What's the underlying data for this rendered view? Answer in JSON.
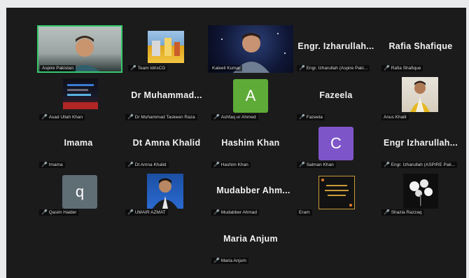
{
  "colors": {
    "meeting_bg": "#1b1b1b",
    "active_speaker_border": "#35c96b",
    "mic_muted": "#e53935",
    "avatar_green": "#5fab37",
    "avatar_purple": "#7e55c9",
    "avatar_slate": "#5f6d75"
  },
  "participants": [
    {
      "label": "Aspire Pakistan",
      "type": "video"
    },
    {
      "label": "Team IdrisCG",
      "type": "image"
    },
    {
      "label": "Kaleeil Kumar",
      "type": "video"
    },
    {
      "name": "Engr.  Izharullah...",
      "label": "Engr. Izharullah (Aspire Paki...",
      "type": "text"
    },
    {
      "name": "Rafia Shafique",
      "label": "Rafia Shafique",
      "type": "text"
    },
    {
      "label": "Asad Ullah Khan",
      "type": "image"
    },
    {
      "name": "Dr  Muhammad...",
      "label": "Dr Muhammad Taskeen Raza",
      "type": "text"
    },
    {
      "initial": "A",
      "label": "Ashfaq ur Ahmed",
      "type": "avatar"
    },
    {
      "name": "Fazeela",
      "label": "Fazeela",
      "type": "text"
    },
    {
      "label": "Anus Khalil",
      "type": "image"
    },
    {
      "name": "Imama",
      "label": "Imama",
      "type": "text"
    },
    {
      "name": "Dt Amna Khalid",
      "label": "Dt Amna Khalid",
      "type": "text"
    },
    {
      "name": "Hashim Khan",
      "label": "Hashim Khan",
      "type": "text"
    },
    {
      "initial": "C",
      "label": "Salman Khan",
      "type": "avatar"
    },
    {
      "name": "Engr   Izharullah...",
      "label": "Engr. Izharullah (ASPIRE Pak...",
      "type": "text"
    },
    {
      "initial": "q",
      "label": "Qasim Haider",
      "type": "avatar"
    },
    {
      "label": "UMAIR AZMAT",
      "type": "image"
    },
    {
      "name": "Mudabber  Ahm...",
      "label": "Mudabber Ahmad",
      "type": "text"
    },
    {
      "label": "Eram",
      "type": "image"
    },
    {
      "label": "Shazia Razzaq",
      "type": "image"
    },
    {
      "name": "Maria Anjum",
      "label": "Maria Anjum",
      "type": "text"
    }
  ]
}
